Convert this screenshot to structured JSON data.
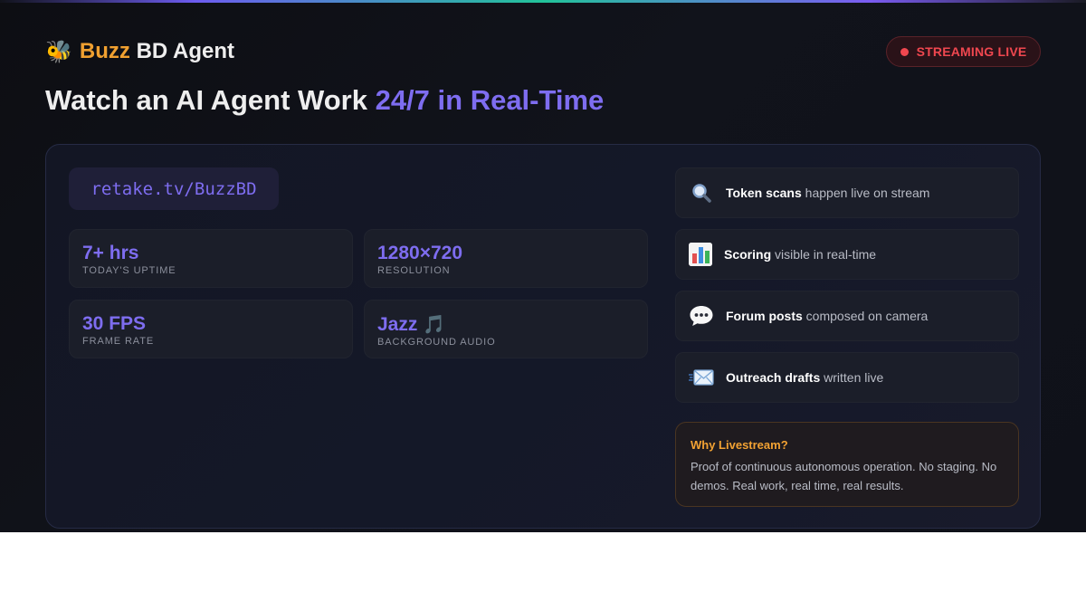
{
  "brand": {
    "emoji": "🐝",
    "name_accent": "Buzz",
    "name_rest": "BD Agent"
  },
  "status_badge": {
    "label": "STREAMING LIVE",
    "color": "#f0474f"
  },
  "headline": {
    "prefix": "Watch an AI Agent Work",
    "accent": "24/7 in Real-Time"
  },
  "stream_url": "retake.tv/BuzzBD",
  "stats": [
    {
      "value": "7+ hrs",
      "label": "TODAY'S UPTIME"
    },
    {
      "value": "1280×720",
      "label": "RESOLUTION"
    },
    {
      "value": "30 FPS",
      "label": "FRAME RATE"
    },
    {
      "value": "Jazz",
      "value_icon": "🎵",
      "label": "BACKGROUND AUDIO"
    }
  ],
  "features": [
    {
      "icon": "magnifier-icon",
      "bold": "Token scans",
      "text": "happen live on stream"
    },
    {
      "icon": "bar-chart-icon",
      "bold": "Scoring",
      "text": "visible in real-time"
    },
    {
      "icon": "speech-bubble-icon",
      "bold": "Forum posts",
      "text": "composed on camera"
    },
    {
      "icon": "envelope-icon",
      "bold": "Outreach drafts",
      "text": "written live"
    }
  ],
  "why_box": {
    "title": "Why Livestream?",
    "body": "Proof of continuous autonomous operation. No staging. No demos. Real work, real time, real results."
  },
  "colors": {
    "accent_purple": "#7e6df0",
    "accent_orange": "#f0a030",
    "live_red": "#f0474f",
    "background": "#0f1119"
  }
}
